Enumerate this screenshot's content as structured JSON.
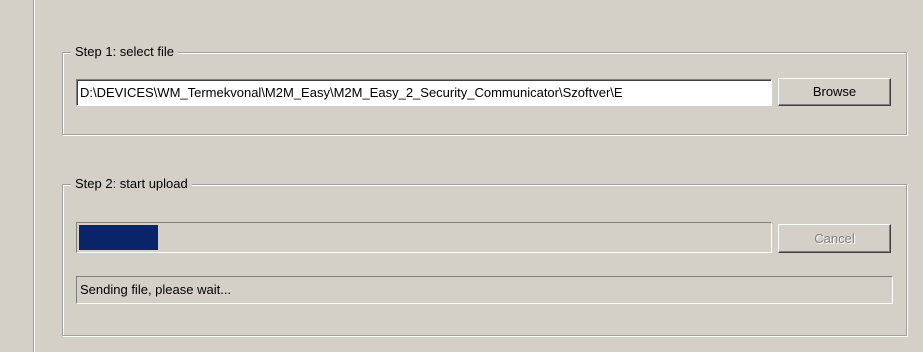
{
  "step1": {
    "title": "Step 1: select file",
    "file_path": "D:\\DEVICES\\WM_Termekvonal\\M2M_Easy\\M2M_Easy_2_Security_Communicator\\Szoftver\\E",
    "browse_label": "Browse"
  },
  "step2": {
    "title": "Step 2: start upload",
    "progress_fraction": 0.115,
    "progress_color": "#0a246a",
    "cancel_label": "Cancel",
    "cancel_enabled": false,
    "status_text": "Sending file, please wait..."
  },
  "colors": {
    "dialog_background": "#d4d0c8"
  }
}
